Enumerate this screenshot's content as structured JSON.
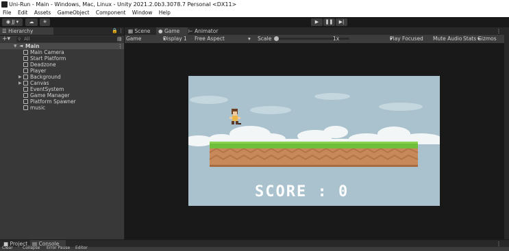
{
  "window": {
    "title": "Uni-Run - Main - Windows, Mac, Linux - Unity 2021.2.0b3.3078.7 Personal <DX11>"
  },
  "menu": {
    "items": [
      "File",
      "Edit",
      "Assets",
      "GameObject",
      "Component",
      "Window",
      "Help"
    ]
  },
  "toolbar": {
    "account_label": "JJ ▾"
  },
  "hierarchy": {
    "tab_label": "Hierarchy",
    "search_placeholder": "All",
    "scene_root": "Main",
    "items": [
      "Main Camera",
      "Start Platform",
      "Deadzone",
      "Player",
      "Background",
      "Canvas",
      "EventSystem",
      "Game Manager",
      "Platform Spawner",
      "music"
    ]
  },
  "view_tabs": {
    "scene": "Scene",
    "game": "Game",
    "animator": "Animator"
  },
  "game_controls": {
    "mode": "Game",
    "display": "Display 1",
    "aspect": "Free Aspect",
    "scale_label": "Scale",
    "scale_value": "1x",
    "play_focused": "Play Focused",
    "mute": "Mute Audio",
    "stats": "Stats",
    "gizmos": "Gizmos"
  },
  "game": {
    "score_text": "SCORE : 0"
  },
  "bottom": {
    "project_tab": "Project",
    "console_tab": "Console",
    "clear_label": "Clear",
    "collapse_label": "Collapse",
    "error_pause": "Error Pause",
    "editor_label": "Editor"
  },
  "colors": {
    "sky": "#a9c2cd",
    "grass": "#6fbf3a",
    "dirt": "#c7895a",
    "panel": "#383838"
  }
}
